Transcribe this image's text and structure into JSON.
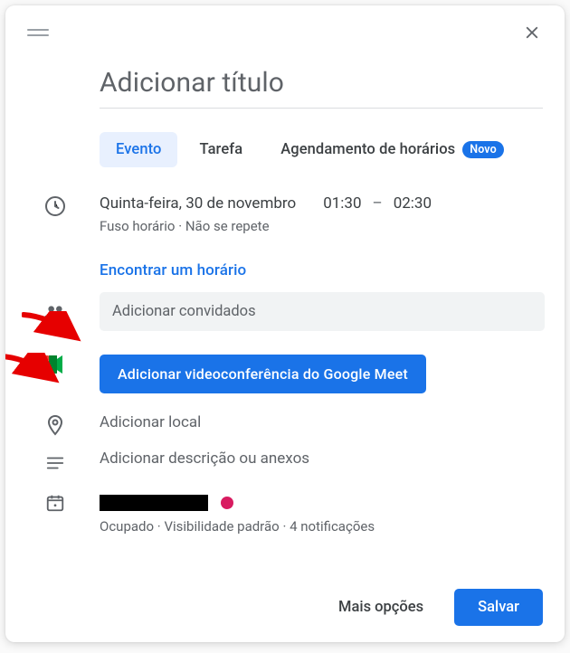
{
  "header": {
    "close_aria": "Fechar"
  },
  "title": {
    "placeholder": "Adicionar título"
  },
  "tabs": {
    "event": "Evento",
    "task": "Tarefa",
    "scheduling": "Agendamento de horários",
    "badge_new": "Novo"
  },
  "datetime": {
    "day": "Quinta-feira, 30 de novembro",
    "start": "01:30",
    "dash": "–",
    "end": "02:30",
    "timezone": "Fuso horário",
    "repeat": "Não se repete",
    "dot": "·"
  },
  "find_time": "Encontrar um horário",
  "guests": {
    "placeholder": "Adicionar convidados"
  },
  "meet": {
    "button": "Adicionar videoconferência do Google Meet"
  },
  "location": {
    "placeholder": "Adicionar local"
  },
  "description": {
    "placeholder": "Adicionar descrição ou anexos"
  },
  "calendar": {
    "status_busy": "Ocupado",
    "visibility": "Visibilidade padrão",
    "notifications": "4 notificações",
    "dot": "·"
  },
  "footer": {
    "more_options": "Mais opções",
    "save": "Salvar"
  }
}
